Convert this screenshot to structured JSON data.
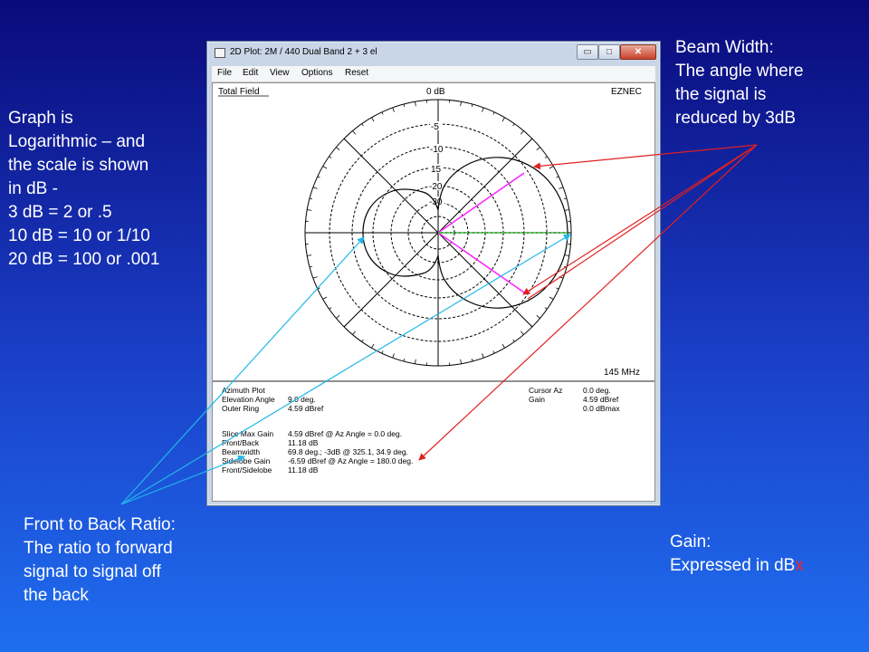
{
  "slide": {
    "left_note": "Graph is\nLogarithmic – and\nthe scale is shown\nin dB -\n3 dB = 2 or .5\n10 dB = 10 or 1/10\n20 dB = 100 or .001",
    "beam_note": "Beam Width:\nThe angle where\nthe signal is\nreduced by 3dB",
    "ftb_note": "Front to Back Ratio:\nThe ratio to forward\nsignal to signal off\nthe back",
    "gain_note_main": "Gain:\nExpressed in dB",
    "gain_note_x": "x",
    "arrow_colors": {
      "red": "#e02020",
      "cyan": "#20b8e8"
    }
  },
  "window": {
    "title": "2D Plot: 2M / 440 Dual Band 2 + 3 el",
    "min_glyph": "▭",
    "max_glyph": "□",
    "close_glyph": "✕",
    "menu": [
      "File",
      "Edit",
      "View",
      "Options",
      "Reset"
    ]
  },
  "plot": {
    "field_label": "Total Field",
    "brand": "EZNEC",
    "freq": "145 MHz",
    "ring_labels": [
      "0 dB",
      "-5",
      "-10",
      "15",
      "-20",
      "-30"
    ],
    "colors": {
      "pattern": "#000000",
      "beam_lines": "#ff20ff",
      "axis_h": "#20d020"
    }
  },
  "info": {
    "left": [
      {
        "label": "Azimuth Plot",
        "value": ""
      },
      {
        "label": "Elevation Angle",
        "value": "9.0 deg."
      },
      {
        "label": "Outer Ring",
        "value": "4.59 dBref"
      },
      {
        "label": "Slice Max Gain",
        "value": "4.59 dBref @ Az Angle = 0.0 deg."
      },
      {
        "label": "Front/Back",
        "value": "11.18 dB"
      },
      {
        "label": "Beamwidth",
        "value": "69.8 deg.; -3dB @ 325.1, 34.9 deg."
      },
      {
        "label": "Sidelobe Gain",
        "value": "-6.59 dBref @ Az Angle = 180.0 deg."
      },
      {
        "label": "Front/Sidelobe",
        "value": "11.18 dB"
      }
    ],
    "right": [
      {
        "label": "Cursor Az",
        "value": "0.0 deg."
      },
      {
        "label": "Gain",
        "value": "4.59 dBref"
      },
      {
        "label": "",
        "value": "0.0 dBmax"
      }
    ]
  }
}
